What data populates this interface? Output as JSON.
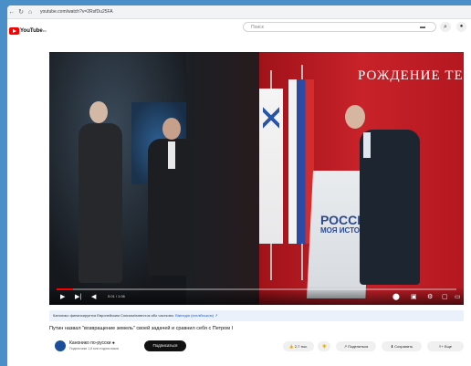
{
  "browser": {
    "back": "←",
    "refresh": "↻",
    "home": "⌂",
    "url": "youtube.com/watch?v=2RsfDu25FA"
  },
  "header": {
    "logo_text": "YouTube",
    "logo_superscript": "RU",
    "search_placeholder": "Поиск"
  },
  "video": {
    "banner_text": "РОЖДЕНИЕ ТЕ",
    "lectern_text": "РОССИЯ",
    "lectern_sub": "МОЯ ИСТОРИЯ",
    "time": "0:01 / 1:06",
    "progress": 0.04
  },
  "info": {
    "notice_text": "Канонико финансируется Европейским Союзом/повесток або частково. ",
    "notice_link": "Вікіпедія (англійською) ↗",
    "title": "Путин назвал \"возвращение земель\" своей задачей и сравнил себя с Петром I",
    "channel_name": "Канонико по-русски ●",
    "channel_subs": "Подписчики 1,8 млн подписчиков",
    "subscribe_label": "Подписаться",
    "likes": "2,7 тыс.",
    "share_label": "Поделиться",
    "save_label": "Сохранить",
    "more_label": "Еще"
  },
  "colors": {
    "accent": "#ff0000",
    "background": "#4b8fc9"
  }
}
